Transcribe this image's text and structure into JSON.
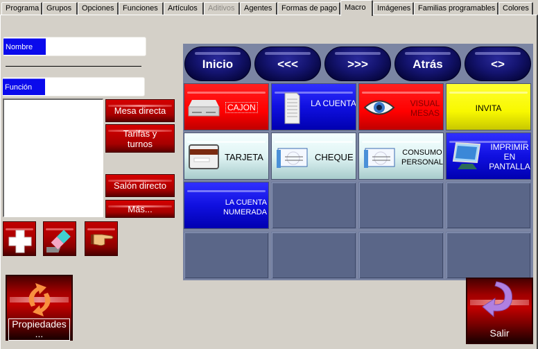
{
  "tabs": [
    {
      "label": "Programa",
      "state": "normal"
    },
    {
      "label": "Grupos",
      "state": "normal"
    },
    {
      "label": "Opciones",
      "state": "normal"
    },
    {
      "label": "Funciones",
      "state": "normal"
    },
    {
      "label": "Artículos",
      "state": "normal"
    },
    {
      "label": "Aditivos",
      "state": "disabled"
    },
    {
      "label": "Agentes",
      "state": "normal"
    },
    {
      "label": "Formas de pago",
      "state": "normal"
    },
    {
      "label": "Macro",
      "state": "active"
    },
    {
      "label": "Imágenes",
      "state": "normal"
    },
    {
      "label": "Familias programables",
      "state": "normal"
    },
    {
      "label": "Colores",
      "state": "normal"
    }
  ],
  "left_panel": {
    "nombre": {
      "label": "Nombre",
      "value": ""
    },
    "funcion": {
      "label": "Función",
      "value": ""
    },
    "buttons": {
      "mesa_directa": "Mesa directa",
      "tarifas_turnos": "Tarifas y turnos",
      "salon_directo": "Salón directo",
      "mas": "Más..."
    },
    "icon_buttons": [
      {
        "name": "add",
        "icon": "plus-icon"
      },
      {
        "name": "erase",
        "icon": "eraser-icon"
      },
      {
        "name": "point",
        "icon": "pointing-hand-icon"
      }
    ],
    "propiedades": "Propiedades ..."
  },
  "nav_buttons": [
    "Inicio",
    "<<<",
    ">>>",
    "Atrás",
    "<>"
  ],
  "macro_grid": [
    {
      "label": "CAJON",
      "style": "red",
      "icon": "cash-drawer-icon",
      "focused": true
    },
    {
      "label": "LA CUENTA",
      "style": "blue",
      "icon": "receipt-icon"
    },
    {
      "label": "VISUAL MESAS",
      "style": "red",
      "icon": "eye-icon"
    },
    {
      "label": "INVITA",
      "style": "yellow",
      "icon": ""
    },
    {
      "label": "TARJETA",
      "style": "cyan",
      "icon": "credit-card-icon"
    },
    {
      "label": "CHEQUE",
      "style": "cyan",
      "icon": "cheque-icon"
    },
    {
      "label": "CONSUMO PERSONAL",
      "style": "cyan",
      "icon": "cheque-icon"
    },
    {
      "label": "IMPRIMIR EN PANTALLA",
      "style": "blue",
      "icon": "monitor-icon"
    },
    {
      "label": "LA CUENTA NUMERADA",
      "style": "blue",
      "icon": ""
    },
    {
      "label": "",
      "style": "empty"
    },
    {
      "label": "",
      "style": "empty"
    },
    {
      "label": "",
      "style": "empty"
    },
    {
      "label": "",
      "style": "empty"
    },
    {
      "label": "",
      "style": "empty"
    },
    {
      "label": "",
      "style": "empty"
    },
    {
      "label": "",
      "style": "empty"
    }
  ],
  "salir": "Salir"
}
